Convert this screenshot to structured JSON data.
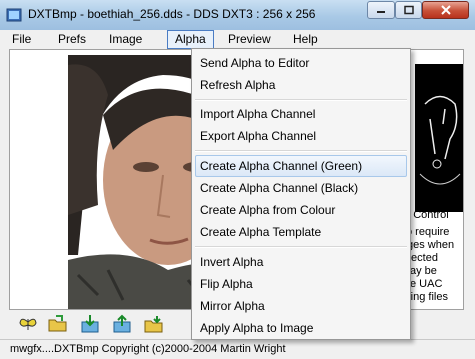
{
  "window": {
    "title": "DXTBmp - boethiah_256.dds - DDS DXT3 : 256 x 256"
  },
  "menubar": {
    "items": [
      {
        "label": "File"
      },
      {
        "label": "Prefs"
      },
      {
        "label": "Image"
      },
      {
        "label": "Alpha"
      },
      {
        "label": "Preview"
      },
      {
        "label": "Help"
      }
    ]
  },
  "alpha_menu": {
    "items": [
      {
        "label": "Send Alpha to Editor"
      },
      {
        "label": "Refresh Alpha"
      },
      {
        "label": "Import Alpha Channel"
      },
      {
        "label": "Export Alpha Channel"
      },
      {
        "label": "Create Alpha Channel (Green)"
      },
      {
        "label": "Create Alpha Channel (Black)"
      },
      {
        "label": "Create Alpha from Colour"
      },
      {
        "label": "Create Alpha Template"
      },
      {
        "label": "Invert Alpha"
      },
      {
        "label": "Flip Alpha"
      },
      {
        "label": "Mirror Alpha"
      },
      {
        "label": "Apply Alpha to Image"
      }
    ]
  },
  "side_text": {
    "lines": [
      "nt Control",
      "o require",
      "ges when",
      "tected",
      "ay be",
      "e UAC",
      "ring files"
    ]
  },
  "status": {
    "text": "mwgfx....DXTBmp Copyright (c)2000-2004 Martin Wright"
  },
  "colors": {
    "titlebar": "#a9c9e6",
    "close_button": "#c75038",
    "menu_highlight": "#dbe8f7"
  }
}
